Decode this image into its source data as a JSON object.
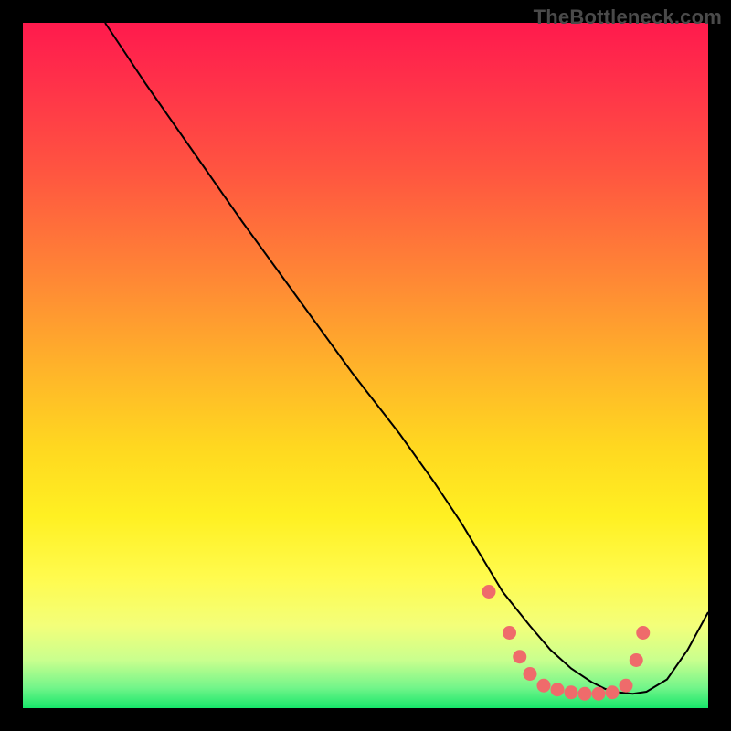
{
  "watermark": "TheBottleneck.com",
  "colors": {
    "dot_fill": "#ef6b6b",
    "curve_stroke": "#000000",
    "frame_bg": "#000000"
  },
  "chart_data": {
    "type": "line",
    "title": "",
    "xlabel": "",
    "ylabel": "",
    "xlim": [
      0,
      100
    ],
    "ylim": [
      0,
      100
    ],
    "note": "No axis ticks or labels rendered; values are normalized (% of plot width/height). Curve falls from top-left, flattens near bottom-right, then rises sharply to right edge.",
    "series": [
      {
        "name": "bottleneck-curve",
        "x": [
          12,
          18,
          25,
          32,
          40,
          48,
          55,
          60,
          64,
          67,
          70,
          74,
          77,
          80,
          83,
          85,
          87,
          89,
          91,
          94,
          97,
          100
        ],
        "y": [
          100,
          91,
          81,
          71,
          60,
          49,
          40,
          33,
          27,
          22,
          17,
          12,
          8.5,
          5.8,
          3.8,
          2.8,
          2.3,
          2.1,
          2.4,
          4.2,
          8.5,
          14
        ]
      }
    ],
    "markers": {
      "name": "highlight-dots",
      "comment": "Salmon dots clustered around the curve minimum",
      "points": [
        {
          "x": 68,
          "y": 17
        },
        {
          "x": 71,
          "y": 11
        },
        {
          "x": 72.5,
          "y": 7.5
        },
        {
          "x": 74,
          "y": 5
        },
        {
          "x": 76,
          "y": 3.3
        },
        {
          "x": 78,
          "y": 2.7
        },
        {
          "x": 80,
          "y": 2.3
        },
        {
          "x": 82,
          "y": 2.1
        },
        {
          "x": 84,
          "y": 2.1
        },
        {
          "x": 86,
          "y": 2.3
        },
        {
          "x": 88,
          "y": 3.3
        },
        {
          "x": 89.5,
          "y": 7
        },
        {
          "x": 90.5,
          "y": 11
        }
      ]
    }
  }
}
